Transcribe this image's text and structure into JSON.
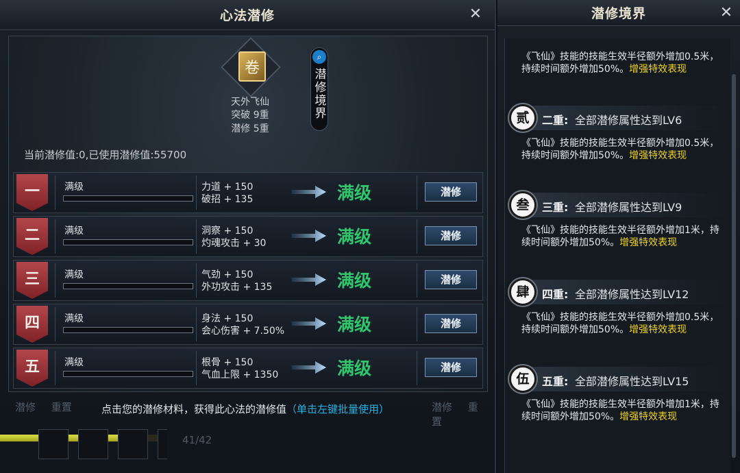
{
  "left_window": {
    "title": "心法潜修",
    "close_glyph": "✕",
    "skill": {
      "icon": "scroll-book-icon",
      "name": "天外飞仙",
      "breakthrough": "突破 9重",
      "cultivation": "潜修 5重"
    },
    "realm_button": {
      "icon": "magnifier-icon",
      "label": "潜修境界"
    },
    "summary": "当前潜修值:0,已使用潜修值:55700",
    "rows": [
      {
        "badge": "一",
        "status": "满级",
        "stat1": "力道 + 150",
        "stat2": "破招 + 135",
        "result": "满级",
        "button": "潜修",
        "progress": 0
      },
      {
        "badge": "二",
        "status": "满级",
        "stat1": "洞察 + 150",
        "stat2": "灼魂攻击 + 30",
        "result": "满级",
        "button": "潜修",
        "progress": 0
      },
      {
        "badge": "三",
        "status": "满级",
        "stat1": "气劲 + 150",
        "stat2": "外功攻击 + 135",
        "result": "满级",
        "button": "潜修",
        "progress": 0
      },
      {
        "badge": "四",
        "status": "满级",
        "stat1": "身法 + 150",
        "stat2": "会心伤害 + 7.50%",
        "result": "满级",
        "button": "潜修",
        "progress": 0
      },
      {
        "badge": "五",
        "status": "满级",
        "stat1": "根骨 + 150",
        "stat2": "气血上限 + 1350",
        "result": "满级",
        "button": "潜修",
        "progress": 0
      }
    ],
    "bottom_tabs_left": [
      "潜修",
      "重置"
    ],
    "bottom_tabs_right": [
      "潜修",
      "重置"
    ],
    "hint": "点击您的潜修材料，获得此心法的潜修值",
    "hint_link": "（单击左键批量使用）",
    "progress": 0.86,
    "page_count": "41/42",
    "colors": {
      "accent_green": "#2fc66c",
      "badge_red": "#9e343a",
      "link_blue": "#2ab0e0",
      "highlight_yellow": "#f1d41f"
    }
  },
  "right_window": {
    "title": "潜修境界",
    "close_glyph": "✕",
    "top_desc": "《飞仙》技能的技能生效半径额外增加0.5米，持续时间额外增加50%。",
    "top_desc_hl": "增强特效表现",
    "tiers": [
      {
        "icon": "贰",
        "name": "二重:",
        "condition": "全部潜修属性达到LV6",
        "desc": "《飞仙》技能的技能生效半径额外增加0.5米，持续时间额外增加50%。",
        "desc_hl": "增强特效表现"
      },
      {
        "icon": "叁",
        "name": "三重:",
        "condition": "全部潜修属性达到LV9",
        "desc": "《飞仙》技能的技能生效半径额外增加1米，持续时间额外增加50%。",
        "desc_hl": "增强特效表现"
      },
      {
        "icon": "肆",
        "name": "四重:",
        "condition": "全部潜修属性达到LV12",
        "desc": "《飞仙》技能的技能生效半径额外增加0.5米，持续时间额外增加50%。",
        "desc_hl": "增强特效表现"
      },
      {
        "icon": "伍",
        "name": "五重:",
        "condition": "全部潜修属性达到LV15",
        "desc": "《飞仙》技能的技能生效半径额外增加1米，持续时间额外增加50%。",
        "desc_hl": "增强特效表现"
      }
    ]
  }
}
